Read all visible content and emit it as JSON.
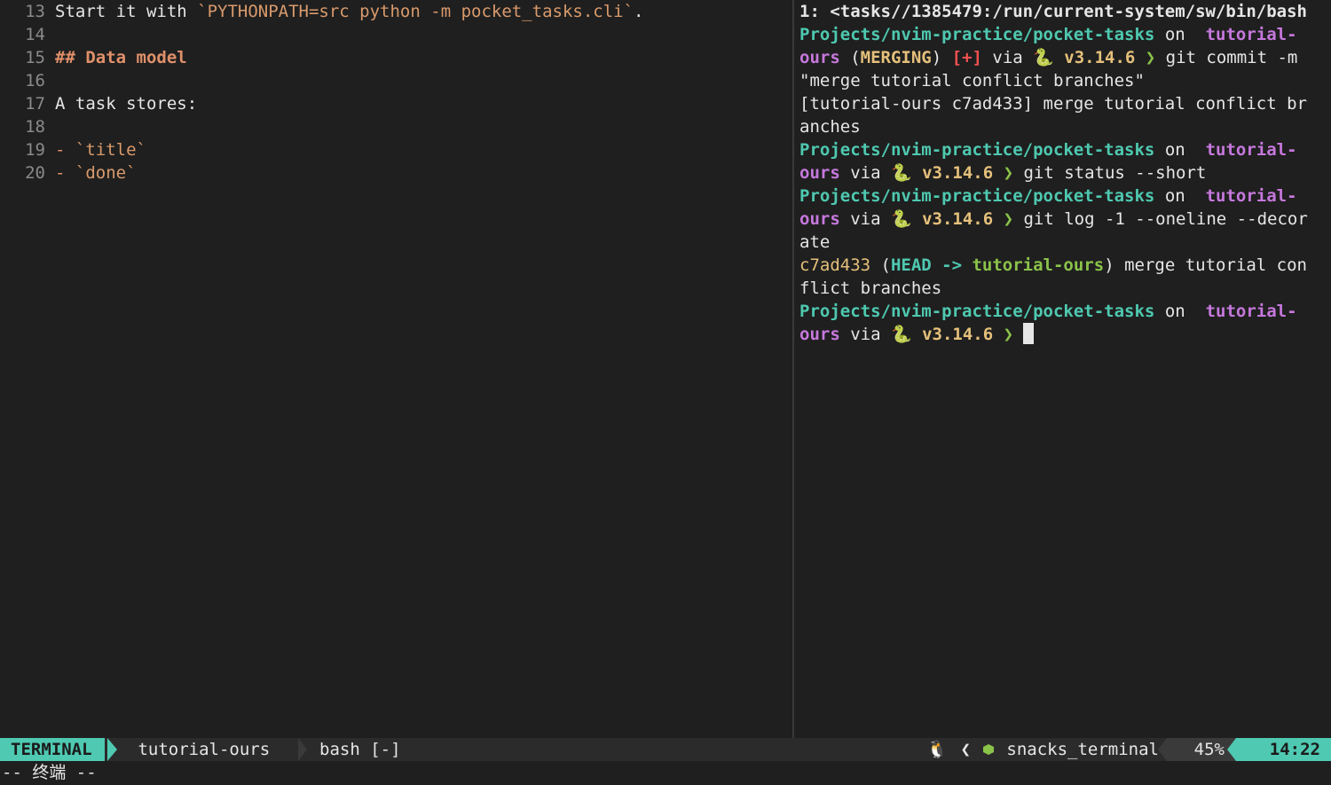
{
  "editor": {
    "lines": [
      {
        "num": "13",
        "parts": [
          {
            "t": "Start it with ",
            "c": "code-text"
          },
          {
            "t": "`PYTHONPATH=src python -m pocket_tasks.cli`",
            "c": "code-inline"
          },
          {
            "t": ".",
            "c": "code-text"
          }
        ]
      },
      {
        "num": "14",
        "parts": []
      },
      {
        "num": "15",
        "parts": [
          {
            "t": "## Data model",
            "c": "heading"
          }
        ]
      },
      {
        "num": "16",
        "parts": []
      },
      {
        "num": "17",
        "parts": [
          {
            "t": "A task stores:",
            "c": "code-text"
          }
        ]
      },
      {
        "num": "18",
        "parts": []
      },
      {
        "num": "19",
        "parts": [
          {
            "t": "- ",
            "c": "bullet"
          },
          {
            "t": "`title`",
            "c": "code-inline"
          }
        ]
      },
      {
        "num": "20",
        "parts": [
          {
            "t": "- ",
            "c": "bullet"
          },
          {
            "t": "`done`",
            "c": "code-inline"
          }
        ]
      }
    ]
  },
  "terminal": {
    "lines": [
      [
        {
          "t": "1: <tasks//1385479:/run/current-system/sw/bin/bash",
          "c": "t-header"
        }
      ],
      [
        {
          "t": "Projects/nvim-practice/pocket-tasks",
          "c": "t-path"
        },
        {
          "t": " on ",
          "c": "t-on"
        },
        {
          "t": " tutorial-",
          "c": "t-branch"
        }
      ],
      [
        {
          "t": "ours",
          "c": "t-branch"
        },
        {
          "t": " (",
          "c": "t-on"
        },
        {
          "t": "MERGING",
          "c": "t-merging"
        },
        {
          "t": ") ",
          "c": "t-on"
        },
        {
          "t": "[+]",
          "c": "t-plus"
        },
        {
          "t": " via ",
          "c": "t-on"
        },
        {
          "t": "🐍 v3.14.6",
          "c": "t-ver"
        },
        {
          "t": " ❯ ",
          "c": "t-arrow"
        },
        {
          "t": "git commit -m",
          "c": "t-cmd"
        }
      ],
      [
        {
          "t": "\"merge tutorial conflict branches\"",
          "c": "t-cmd"
        }
      ],
      [
        {
          "t": "[tutorial-ours c7ad433] merge tutorial conflict br",
          "c": "t-out"
        }
      ],
      [
        {
          "t": "anches",
          "c": "t-out"
        }
      ],
      [
        {
          "t": "Projects/nvim-practice/pocket-tasks",
          "c": "t-path"
        },
        {
          "t": " on ",
          "c": "t-on"
        },
        {
          "t": " tutorial-",
          "c": "t-branch"
        }
      ],
      [
        {
          "t": "ours",
          "c": "t-branch"
        },
        {
          "t": " via ",
          "c": "t-on"
        },
        {
          "t": "🐍 v3.14.6",
          "c": "t-ver"
        },
        {
          "t": " ❯ ",
          "c": "t-arrow"
        },
        {
          "t": "git status --short",
          "c": "t-cmd"
        }
      ],
      [
        {
          "t": "Projects/nvim-practice/pocket-tasks",
          "c": "t-path"
        },
        {
          "t": " on ",
          "c": "t-on"
        },
        {
          "t": " tutorial-",
          "c": "t-branch"
        }
      ],
      [
        {
          "t": "ours",
          "c": "t-branch"
        },
        {
          "t": " via ",
          "c": "t-on"
        },
        {
          "t": "🐍 v3.14.6",
          "c": "t-ver"
        },
        {
          "t": " ❯ ",
          "c": "t-arrow"
        },
        {
          "t": "git log -1 --oneline --decor",
          "c": "t-cmd"
        }
      ],
      [
        {
          "t": "ate",
          "c": "t-cmd"
        }
      ],
      [
        {
          "t": "c7ad433",
          "c": "t-hash"
        },
        {
          "t": " (",
          "c": "t-out"
        },
        {
          "t": "HEAD -> ",
          "c": "t-head"
        },
        {
          "t": "tutorial-ours",
          "c": "t-refbranch"
        },
        {
          "t": ") merge tutorial con",
          "c": "t-out"
        }
      ],
      [
        {
          "t": "flict branches",
          "c": "t-out"
        }
      ],
      [
        {
          "t": "Projects/nvim-practice/pocket-tasks",
          "c": "t-path"
        },
        {
          "t": " on ",
          "c": "t-on"
        },
        {
          "t": " tutorial-",
          "c": "t-branch"
        }
      ],
      [
        {
          "t": "ours",
          "c": "t-branch"
        },
        {
          "t": " via ",
          "c": "t-on"
        },
        {
          "t": "🐍 v3.14.6",
          "c": "t-ver"
        },
        {
          "t": " ❯ ",
          "c": "t-arrow"
        }
      ]
    ]
  },
  "statusline": {
    "mode": "TERMINAL",
    "branch": " tutorial-ours",
    "file": "bash [-]",
    "os_icon": "linux-icon",
    "os_glyph": "🐧",
    "chevron": "❮",
    "filetype": "snacks_terminal",
    "percent": "45%",
    "time": "14:22"
  },
  "cmdline": {
    "text": "-- 终端 --"
  },
  "colors": {
    "accent": "#4fc9b2",
    "path": "#4ec9b0",
    "branch": "#c678dd",
    "version": "#e5c07b",
    "prompt_arrow": "#8bc34a",
    "error": "#f05050"
  }
}
